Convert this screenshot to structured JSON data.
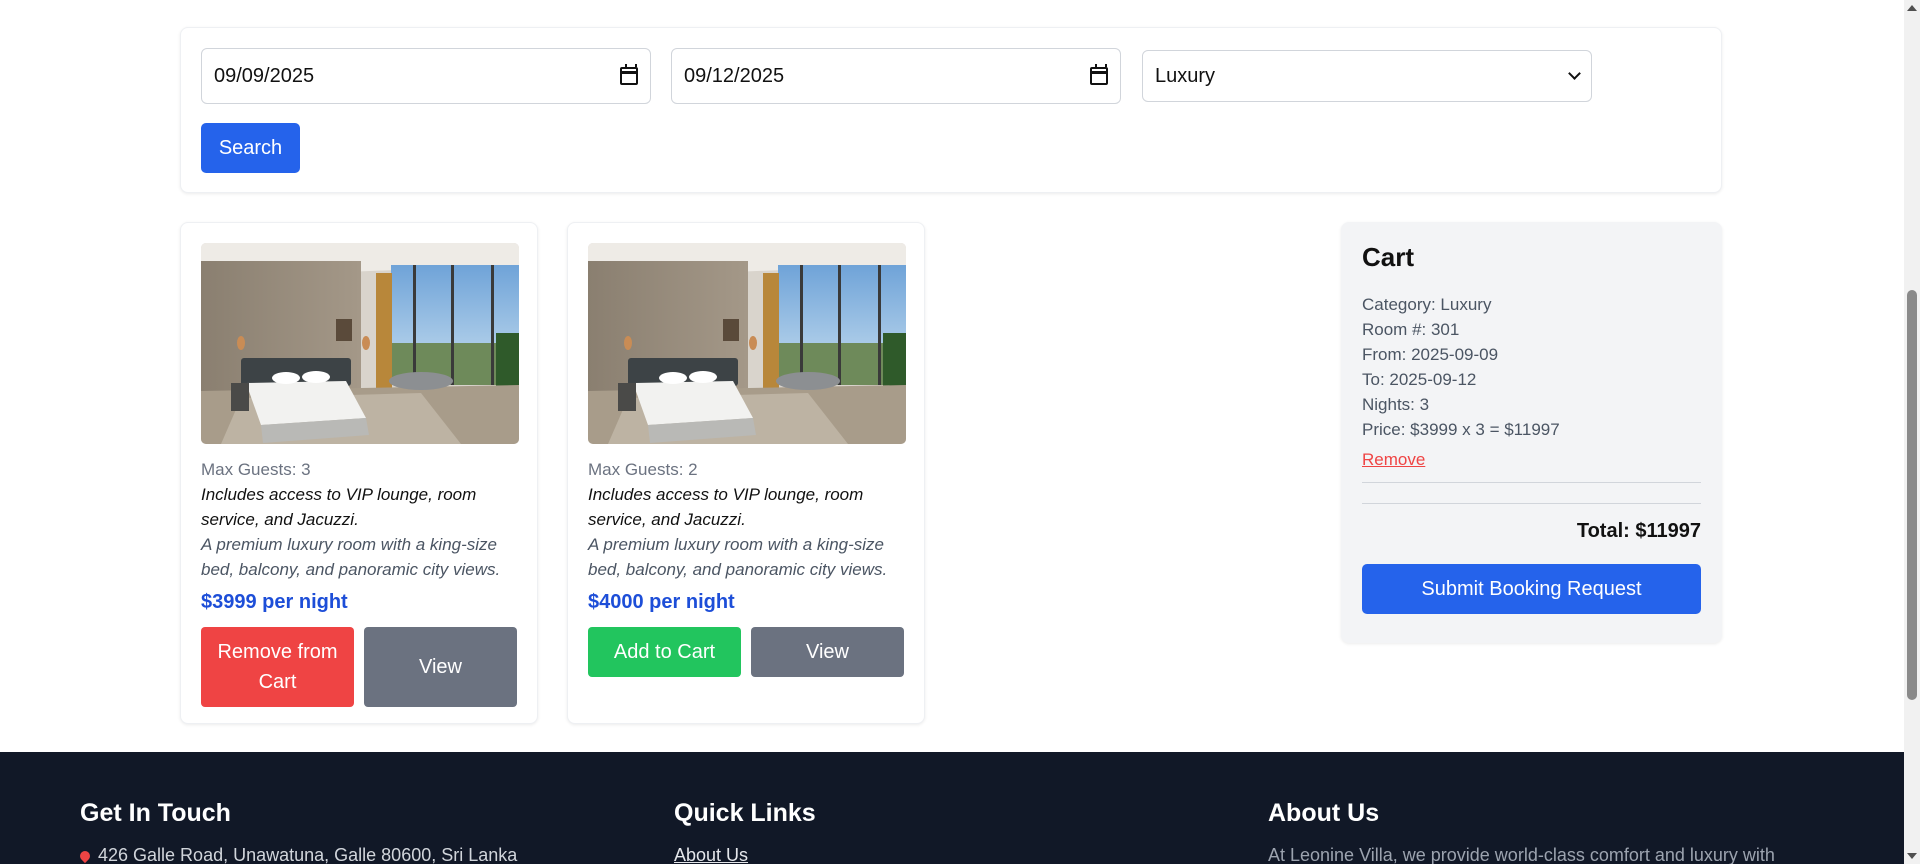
{
  "search": {
    "check_in": "09/09/2025",
    "check_out": "09/12/2025",
    "category": "Luxury",
    "search_label": "Search"
  },
  "rooms": [
    {
      "max_guests": "Max Guests: 3",
      "amenities": "Includes access to VIP lounge, room service, and Jacuzzi.",
      "description": "A premium luxury room with a king-size bed, balcony, and panoramic city views.",
      "price": "$3999 per night",
      "primary_action": "Remove from Cart",
      "view_label": "View"
    },
    {
      "max_guests": "Max Guests: 2",
      "amenities": "Includes access to VIP lounge, room service, and Jacuzzi.",
      "description": "A premium luxury room with a king-size bed, balcony, and panoramic city views.",
      "price": "$4000 per night",
      "primary_action": "Add to Cart",
      "view_label": "View"
    }
  ],
  "cart": {
    "title": "Cart",
    "category": "Category: Luxury",
    "room": "Room #: 301",
    "from": "From: 2025-09-09",
    "to": "To: 2025-09-12",
    "nights": "Nights: 3",
    "price": "Price: $3999 x 3 = $11997",
    "remove_label": "Remove",
    "total": "Total: $11997",
    "submit_label": "Submit Booking Request"
  },
  "footer": {
    "contact_title": "Get In Touch",
    "address": "426 Galle Road, Unawatuna, Galle 80600, Sri Lanka",
    "links_title": "Quick Links",
    "link_about": "About Us",
    "about_title": "About Us",
    "about_text": "At Leonine Villa, we provide world-class comfort and luxury with"
  },
  "colors": {
    "primary": "#2563eb",
    "danger": "#ef4444",
    "success": "#22c55e",
    "secondary": "#6b7280",
    "footer_bg": "#111827"
  },
  "icons": [
    "calendar-icon",
    "chevron-down-icon",
    "location-pin-icon"
  ]
}
